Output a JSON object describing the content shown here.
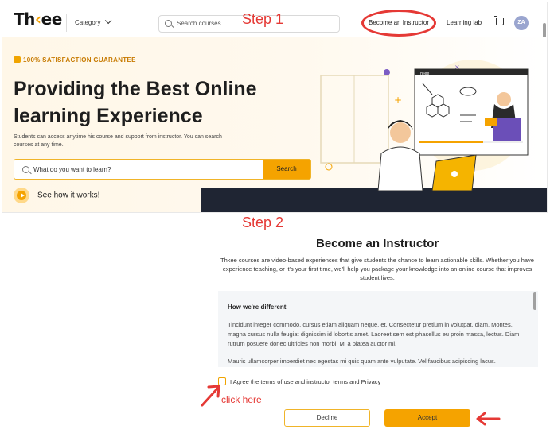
{
  "header": {
    "logo_part1": "Th",
    "logo_accent": "‹",
    "logo_part2": "ee",
    "category_label": "Category",
    "search_placeholder": "Search courses",
    "become_instructor": "Become an Instructor",
    "learning_lab": "Learning lab",
    "avatar_initials": "ZA"
  },
  "annotations": {
    "step1": "Step 1",
    "step2": "Step 2",
    "click_here": "click here"
  },
  "hero": {
    "guarantee": "100% SATISFACTION GUARANTEE",
    "title_line1": "Providing the Best Online",
    "title_line2": "learning Experience",
    "subtitle": "Students can access anytime his course and support from instructor. You can search courses at any time.",
    "search_placeholder": "What do you want to learn?",
    "search_button": "Search",
    "how_it_works": "See how it works!"
  },
  "illustration": {
    "video_logo": "Th‹ee"
  },
  "modal": {
    "title": "Become an Instructor",
    "intro": "Thkee courses are video-based experiences that give students the chance to learn actionable skills. Whether you have experience teaching, or it's your first time, we'll help you package your knowledge into an online course that improves student lives.",
    "box_heading": "How we're different",
    "paragraph1": "Tincidunt integer commodo, cursus etiam aliquam neque, et. Consectetur pretium in volutpat, diam. Montes, magna cursus nulla feugiat dignissim id lobortis amet. Laoreet sem est phasellus eu proin massa, lectus. Diam rutrum posuere donec ultricies non morbi. Mi a platea auctor mi.",
    "paragraph2": "Mauris ullamcorper imperdiet nec egestas mi quis quam ante vulputate. Vel faucibus adipiscing lacus.",
    "agree_label": "I Agree the terms of use and instructor terms and Privacy",
    "decline_button": "Decline",
    "accept_button": "Accept"
  },
  "colors": {
    "accent": "#f5a300",
    "annotation_red": "#e53935",
    "dark_band": "#1f2533"
  }
}
